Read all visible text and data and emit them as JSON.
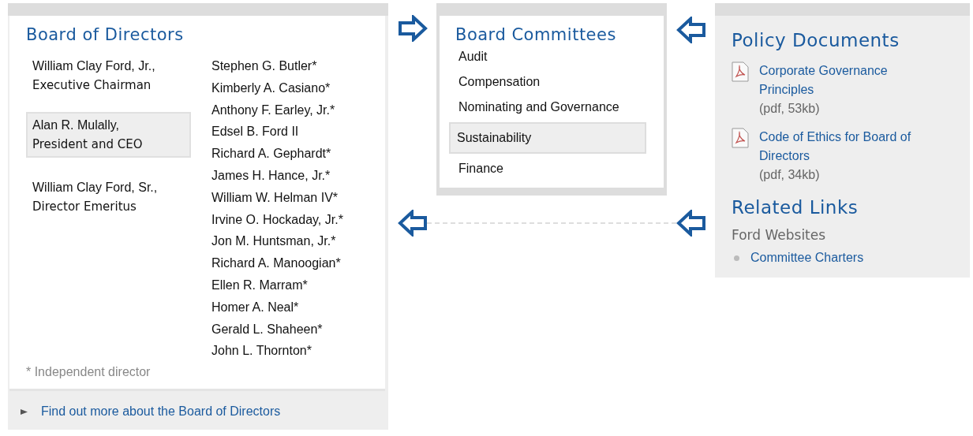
{
  "board": {
    "title": "Board of Directors",
    "officers": [
      {
        "name": "William Clay Ford, Jr.,",
        "role": "Executive Chairman",
        "selected": false
      },
      {
        "name": "Alan R. Mulally,",
        "role": "President and CEO",
        "selected": true
      },
      {
        "name": "William Clay Ford, Sr.,",
        "role": "Director Emeritus",
        "selected": false
      }
    ],
    "directors": [
      "Stephen G. Butler*",
      "Kimberly A. Casiano*",
      "Anthony F. Earley, Jr.*",
      "Edsel B. Ford II",
      "Richard A. Gephardt*",
      "James H. Hance, Jr.*",
      "William W. Helman IV*",
      "Irvine O. Hockaday, Jr.*",
      "Jon M. Huntsman, Jr.*",
      "Richard A. Manoogian*",
      "Ellen R. Marram*",
      "Homer A. Neal*",
      "Gerald L. Shaheen*",
      "John L. Thornton*"
    ],
    "footnote": "* Independent director",
    "more_link": "Find out more about the Board of Directors"
  },
  "committees": {
    "title": "Board Committees",
    "items": [
      {
        "label": "Audit",
        "selected": false
      },
      {
        "label": "Compensation",
        "selected": false
      },
      {
        "label": "Nominating and Governance",
        "selected": false
      },
      {
        "label": "Sustainability",
        "selected": true
      },
      {
        "label": "Finance",
        "selected": false
      }
    ]
  },
  "policy": {
    "title": "Policy Documents",
    "documents": [
      {
        "link": "Corporate Governance Principles",
        "size": "(pdf, 53kb)"
      },
      {
        "link": "Code of Ethics for Board of Directors",
        "size": "(pdf, 34kb)"
      }
    ]
  },
  "related": {
    "title": "Related Links",
    "subtitle": "Ford Websites",
    "links": [
      "Committee Charters"
    ]
  }
}
